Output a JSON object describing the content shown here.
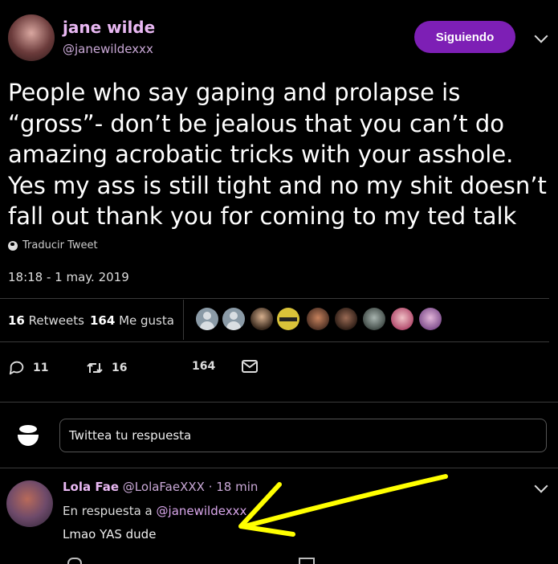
{
  "tweet": {
    "author_name": "jane wilde",
    "author_handle": "@janewildexxx",
    "follow_label": "Siguiendo",
    "text": "People who say gaping and prolapse is\n“gross”- don’t be jealous that you can’t do\namazing acrobatic tricks with your asshole.\nYes my ass is still tight and no my shit doesn’t\nfall out thank you for coming to my ted talk",
    "translate_label": "Traducir Tweet",
    "timestamp": "18:18 - 1 may. 2019",
    "retweets_count": "16",
    "retweets_label": "Retweets",
    "likes_count": "164",
    "likes_label": "Me gusta"
  },
  "actions": {
    "reply_count": "11",
    "retweet_count": "16",
    "like_count": "164"
  },
  "reply_composer": {
    "placeholder": "Twittea tu respuesta"
  },
  "reply": {
    "author_name": "Lola Fae",
    "author_handle": "@LolaFaeXXX",
    "time": "· 18 min",
    "in_reply_prefix": "En respuesta a",
    "in_reply_handle": "@janewildexxx",
    "text": "Lmao YAS dude"
  },
  "colors": {
    "accent": "#7d1fb5",
    "name": "#e9b8f3",
    "arrow": "#ffff00"
  }
}
